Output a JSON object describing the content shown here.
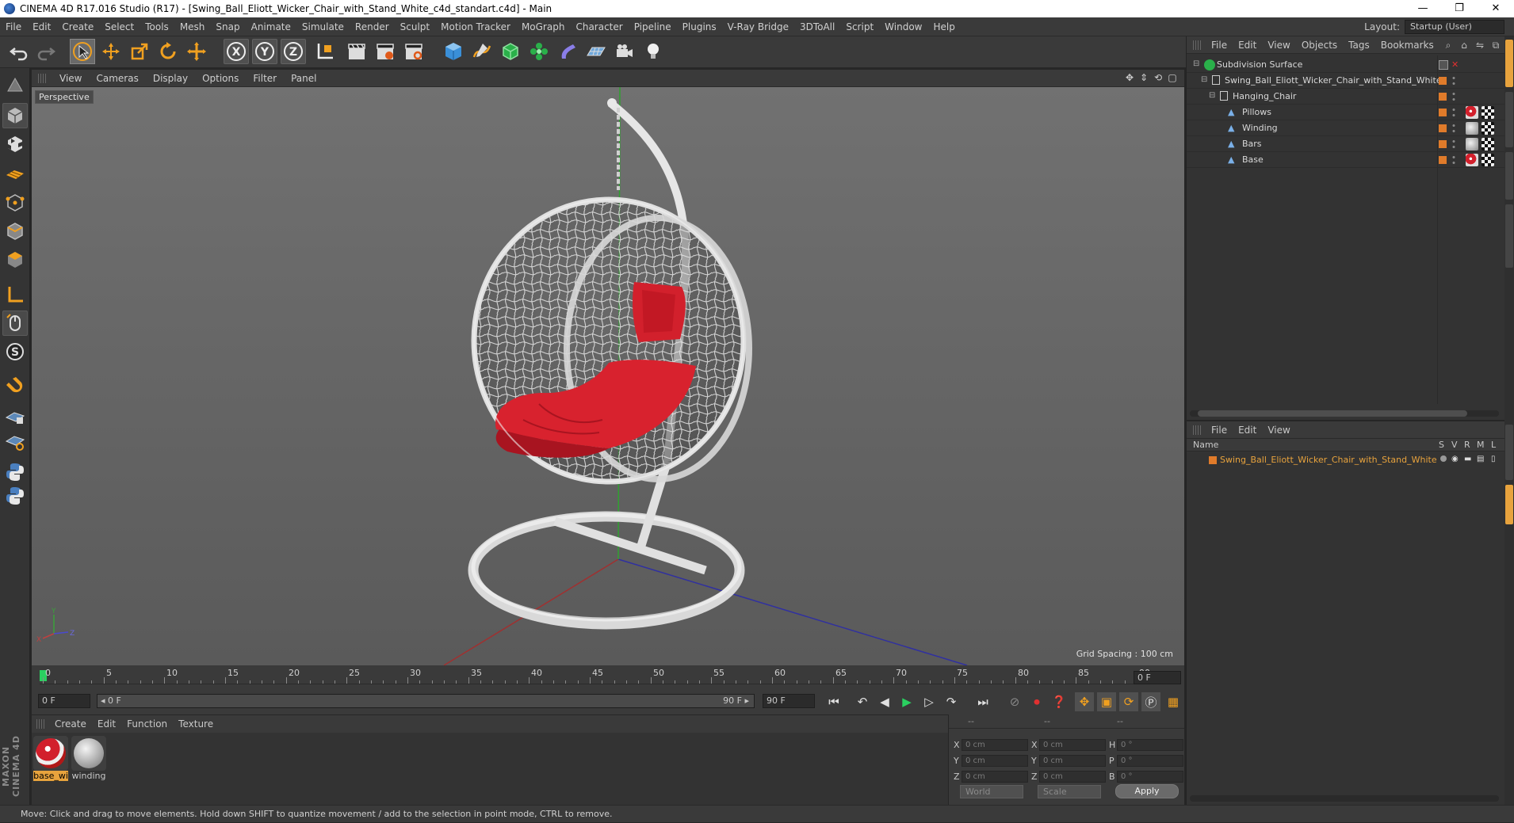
{
  "window": {
    "title": "CINEMA 4D R17.016 Studio (R17) - [Swing_Ball_Eliott_Wicker_Chair_with_Stand_White_c4d_standart.c4d] - Main",
    "minimize": "—",
    "restore": "❐",
    "close": "✕"
  },
  "menubar": {
    "items": [
      "File",
      "Edit",
      "Create",
      "Select",
      "Tools",
      "Mesh",
      "Snap",
      "Animate",
      "Simulate",
      "Render",
      "Sculpt",
      "Motion Tracker",
      "MoGraph",
      "Character",
      "Pipeline",
      "Plugins",
      "V-Ray Bridge",
      "3DToAll",
      "Script",
      "Window",
      "Help"
    ],
    "layout_label": "Layout:",
    "layout_value": "Startup (User)"
  },
  "viewport": {
    "menu": [
      "View",
      "Cameras",
      "Display",
      "Options",
      "Filter",
      "Panel"
    ],
    "camera_label": "Perspective",
    "grid_spacing": "Grid Spacing : 100 cm"
  },
  "timeline": {
    "ticks": [
      "0",
      "5",
      "10",
      "15",
      "20",
      "25",
      "30",
      "35",
      "40",
      "45",
      "50",
      "55",
      "60",
      "65",
      "70",
      "75",
      "80",
      "85",
      "90"
    ],
    "current_frame": "0 F",
    "start_field": "0 F",
    "range_start": "◂ 0 F",
    "range_end": "90 F ▸",
    "end_field": "90 F"
  },
  "materials": {
    "menu": [
      "Create",
      "Edit",
      "Function",
      "Texture"
    ],
    "items": [
      {
        "label": "base_wi",
        "selected": true
      },
      {
        "label": "winding",
        "selected": false
      }
    ]
  },
  "coordinates": {
    "header": [
      "--",
      "--",
      "--"
    ],
    "rows": [
      {
        "a": "X",
        "av": "0 cm",
        "b": "X",
        "bv": "0 cm",
        "c": "H",
        "cv": "0 °"
      },
      {
        "a": "Y",
        "av": "0 cm",
        "b": "Y",
        "bv": "0 cm",
        "c": "P",
        "cv": "0 °"
      },
      {
        "a": "Z",
        "av": "0 cm",
        "b": "Z",
        "bv": "0 cm",
        "c": "B",
        "cv": "0 °"
      }
    ],
    "mode": "World",
    "scale": "Scale",
    "apply": "Apply"
  },
  "object_manager": {
    "menu": [
      "File",
      "Edit",
      "View",
      "Objects",
      "Tags",
      "Bookmarks"
    ],
    "objects": [
      {
        "name": "Subdivision Surface",
        "level": 0
      },
      {
        "name": "Swing_Ball_Eliott_Wicker_Chair_with_Stand_White",
        "level": 1
      },
      {
        "name": "Hanging_Chair",
        "level": 2
      },
      {
        "name": "Pillows",
        "level": 3
      },
      {
        "name": "Winding",
        "level": 3
      },
      {
        "name": "Bars",
        "level": 3
      },
      {
        "name": "Base",
        "level": 3
      }
    ]
  },
  "attribute_manager": {
    "menu": [
      "File",
      "Edit",
      "View"
    ],
    "columns": [
      "Name",
      "S",
      "V",
      "R",
      "M",
      "L"
    ],
    "layer_name": "Swing_Ball_Eliott_Wicker_Chair_with_Stand_White"
  },
  "status": "Move: Click and drag to move elements. Hold down SHIFT to quantize movement / add to the selection in point mode, CTRL to remove.",
  "colors": {
    "accent": "#e8a33d",
    "layer": "#e07b2a",
    "pillow_red": "#d2202c",
    "active_tool": "#f0a020"
  }
}
